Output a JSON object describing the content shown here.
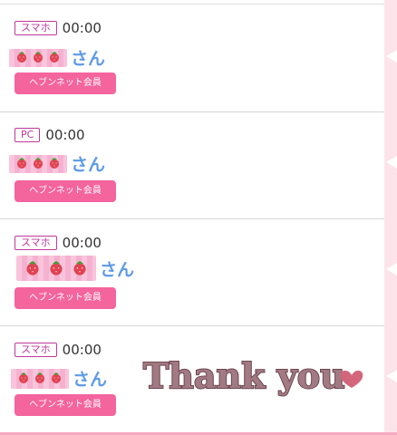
{
  "entries": [
    {
      "device": "スマホ",
      "time": "00:00",
      "suffix": "さん",
      "member_label": "ヘブンネット会員"
    },
    {
      "device": "PC",
      "time": "00:00",
      "suffix": "さん",
      "member_label": "ヘブンネット会員"
    },
    {
      "device": "スマホ",
      "time": "00:00",
      "suffix": "さん",
      "member_label": "ヘブンネット会員"
    },
    {
      "device": "スマホ",
      "time": "00:00",
      "suffix": "さん",
      "member_label": "ヘブンネット会員"
    }
  ],
  "stamp": {
    "text": "Thank you"
  },
  "colors": {
    "accent": "#f4649d",
    "device_border": "#c0399b",
    "name": "#5f9be6",
    "side": "#fce4ea"
  }
}
